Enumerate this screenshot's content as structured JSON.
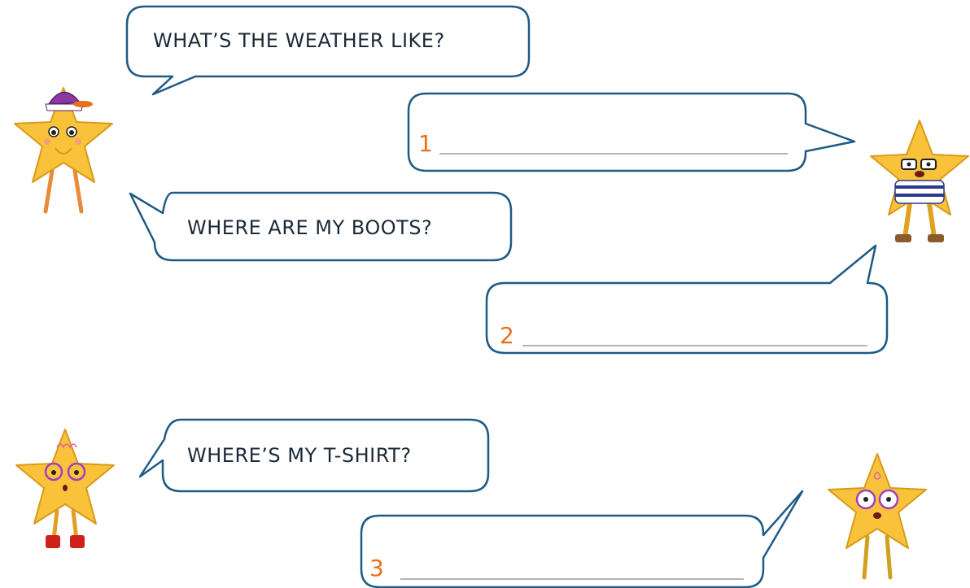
{
  "questions": [
    {
      "text": "WHAT’S THE WEATHER LIKE?"
    },
    {
      "text": "WHERE ARE MY BOOTS?"
    },
    {
      "text": "WHERE’S MY T-SHIRT?"
    }
  ],
  "answers": [
    {
      "number": "1"
    },
    {
      "number": "2"
    },
    {
      "number": "3"
    }
  ],
  "colors": {
    "bubble_stroke": "#1f5a85",
    "number": "#e8701a",
    "answer_line": "#9a9a9a",
    "star_fill": "#f8c23a"
  },
  "characters": [
    {
      "icon": "star-cap-character-icon"
    },
    {
      "icon": "star-striped-shirt-character-icon"
    },
    {
      "icon": "star-pink-glasses-character-icon"
    },
    {
      "icon": "star-round-glasses-character-icon"
    }
  ]
}
